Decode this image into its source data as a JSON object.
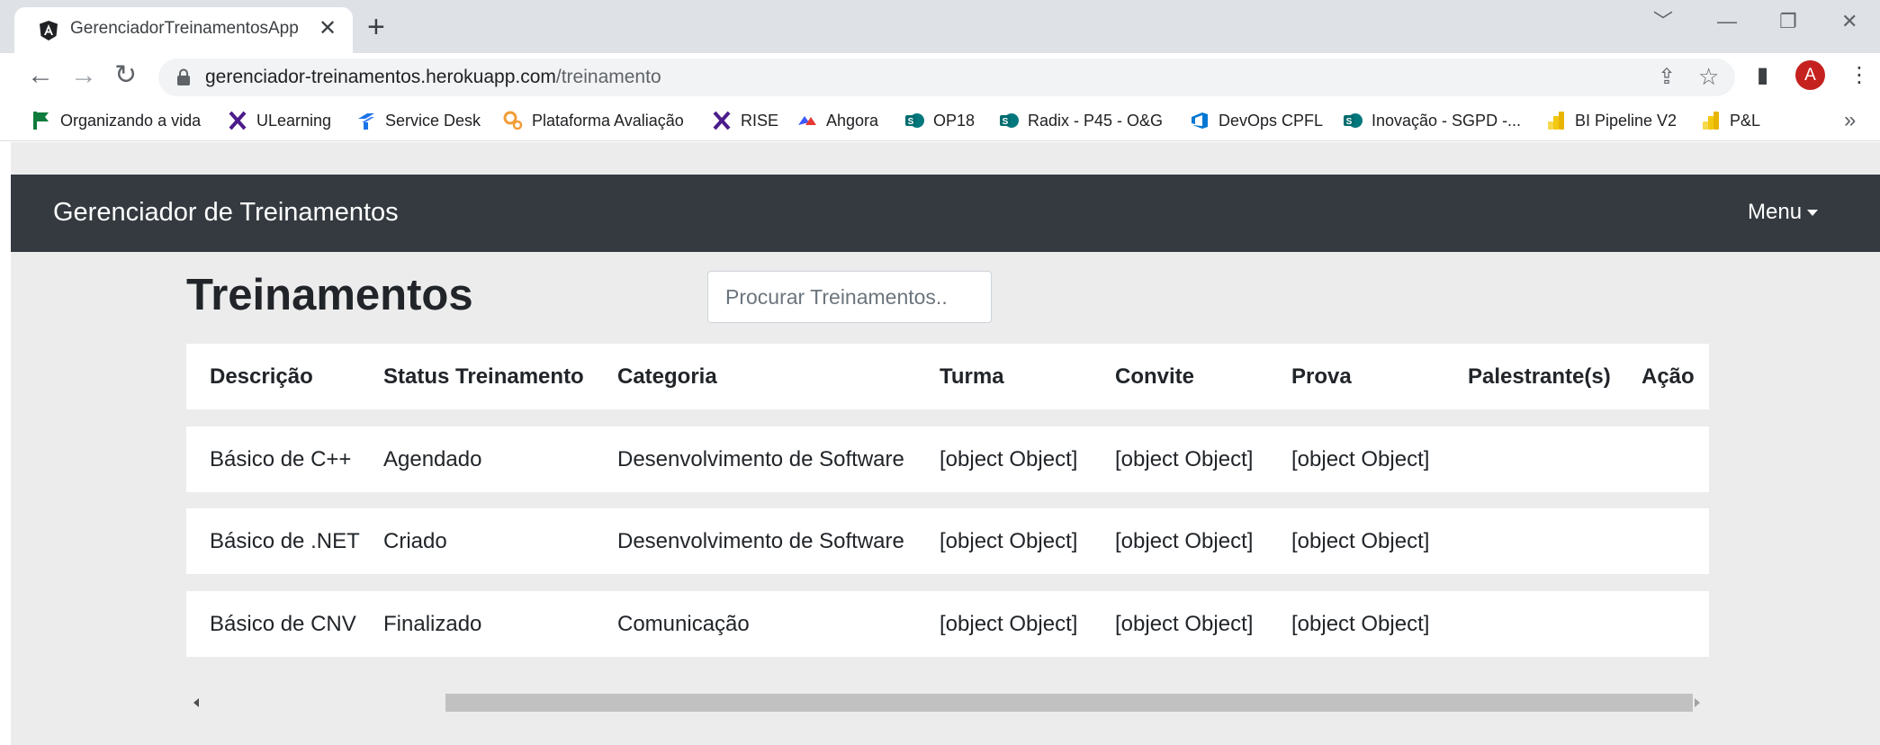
{
  "browser": {
    "tab_title": "GerenciadorTreinamentosApp",
    "tab_close": "✕",
    "new_tab": "+",
    "window_controls": [
      "﹀",
      "—",
      "❐",
      "✕"
    ],
    "nav": {
      "back": "←",
      "forward": "→",
      "reload": "↻"
    },
    "url_host": "gerenciador-treinamentos.herokuapp.com",
    "url_path": "/treinamento",
    "toolbar_icons": {
      "share": "⇪",
      "star": "☆",
      "sidepanel": "▮",
      "profile": "A",
      "menu": "⋮"
    },
    "bookmarks": [
      {
        "label": "Organizando a vida",
        "icon": "flag-icon",
        "color": "#0f7b3c"
      },
      {
        "label": "ULearning",
        "icon": "x-logo-icon",
        "color": "#4b1c8a"
      },
      {
        "label": "Service Desk",
        "icon": "service-desk-icon",
        "color": "#1a73e8"
      },
      {
        "label": "Plataforma Avaliação",
        "icon": "gears-icon",
        "color": "#f29d38"
      },
      {
        "label": "RISE",
        "icon": "x-logo-icon",
        "color": "#4b1c8a"
      },
      {
        "label": "Ahgora",
        "icon": "ahgora-icon",
        "color": "#3d5afe"
      },
      {
        "label": "OP18",
        "icon": "sharepoint-icon",
        "color": "#038387"
      },
      {
        "label": "Radix - P45 - O&G",
        "icon": "sharepoint-icon",
        "color": "#038387"
      },
      {
        "label": "DevOps CPFL",
        "icon": "devops-icon",
        "color": "#0078d4"
      },
      {
        "label": "Inovação - SGPD -...",
        "icon": "sharepoint-icon",
        "color": "#038387"
      },
      {
        "label": "BI Pipeline V2",
        "icon": "powerbi-icon",
        "color": "#f2c811"
      },
      {
        "label": "P&L",
        "icon": "powerbi-icon",
        "color": "#f2c811"
      }
    ],
    "bookmarks_more": "»"
  },
  "app": {
    "brand": "Gerenciador de Treinamentos",
    "menu_label": "Menu"
  },
  "main": {
    "title": "Treinamentos",
    "search_placeholder": "Procurar Treinamentos..",
    "columns": [
      "Descrição",
      "Status Treinamento",
      "Categoria",
      "Turma",
      "Convite",
      "Prova",
      "Palestrante(s)",
      "Ação"
    ],
    "rows": [
      [
        "Básico de C++",
        "Agendado",
        "Desenvolvimento de Software",
        "[object Object]",
        "[object Object]",
        "[object Object]",
        "",
        ""
      ],
      [
        "Básico de .NET",
        "Criado",
        "Desenvolvimento de Software",
        "[object Object]",
        "[object Object]",
        "[object Object]",
        "",
        ""
      ],
      [
        "Básico de CNV",
        "Finalizado",
        "Comunicação",
        "[object Object]",
        "[object Object]",
        "[object Object]",
        "",
        ""
      ]
    ]
  }
}
